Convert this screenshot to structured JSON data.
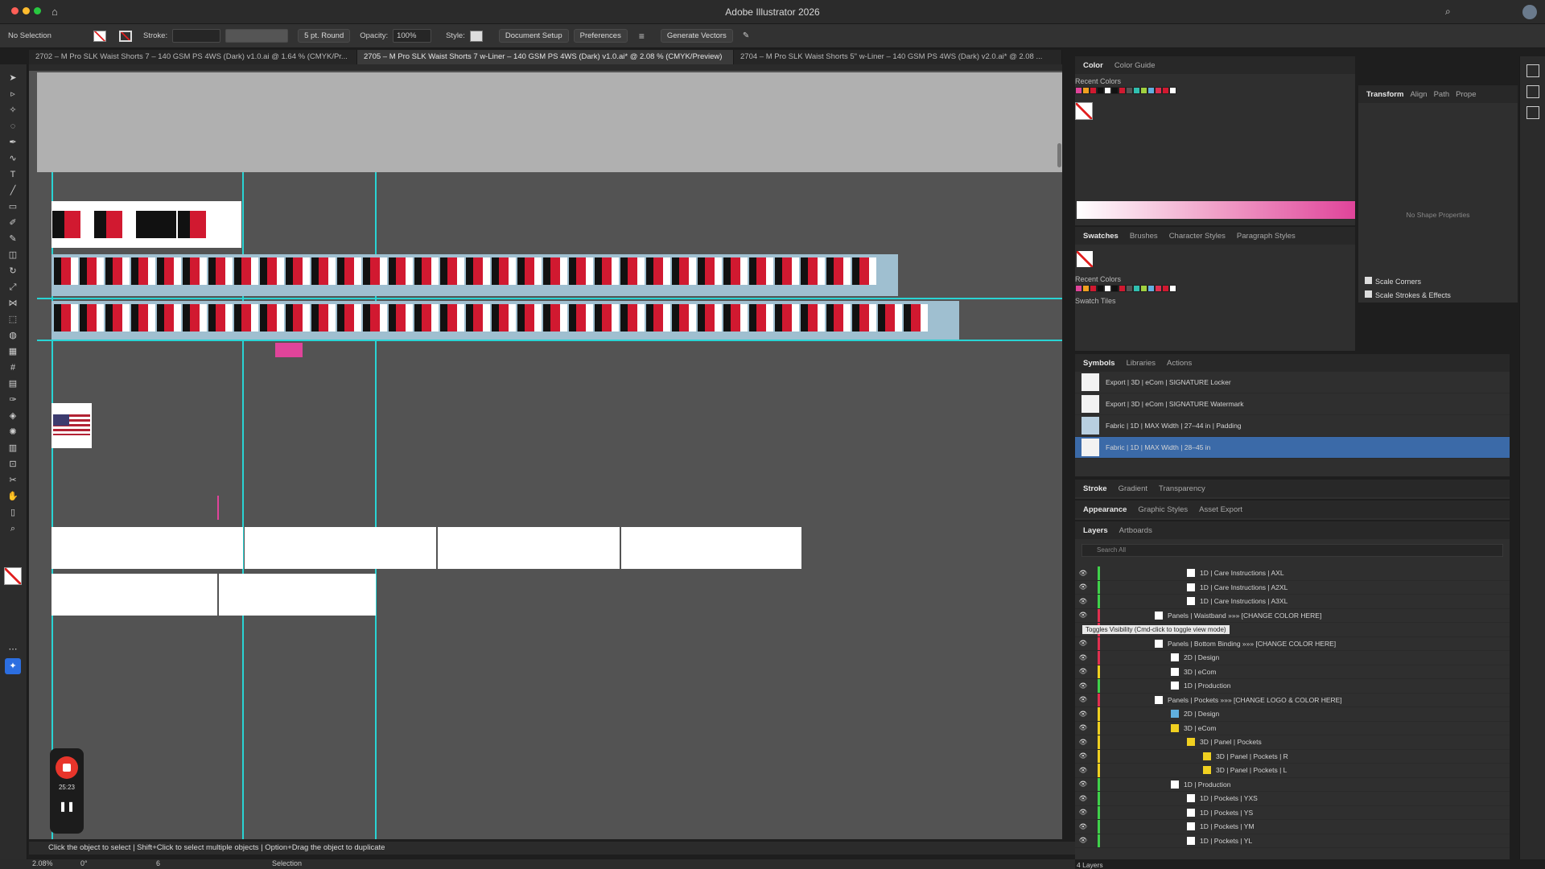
{
  "app": {
    "title": "Adobe Illustrator 2026"
  },
  "control_bar": {
    "selection": "No Selection",
    "stroke_label": "Stroke:",
    "brush": "5 pt. Round",
    "opacity_label": "Opacity:",
    "opacity_value": "100%",
    "style_label": "Style:",
    "document_setup": "Document Setup",
    "preferences": "Preferences",
    "generate_vectors": "Generate Vectors"
  },
  "tabs": [
    "2702 – M Pro SLK Waist Shorts 7 – 140 GSM PS 4WS (Dark) v1.0.ai @ 1.64 % (CMYK/Pr...",
    "2705 – M Pro SLK Waist Shorts 7 w-Liner – 140 GSM PS 4WS (Dark) v1.0.ai* @ 2.08 % (CMYK/Preview)",
    "2704 – M Pro SLK Waist Shorts 5\" w-Liner – 140 GSM PS 4WS (Dark) v2.0.ai* @ 2.08 ..."
  ],
  "color_panel": {
    "tabs": [
      "Color",
      "Color Guide"
    ],
    "recent_colors": "Recent Colors"
  },
  "transform_panel": {
    "tabs": [
      "Transform",
      "Align",
      "Path",
      "Prope"
    ],
    "no_shape": "No Shape Properties",
    "scale_corners": "Scale Corners",
    "scale_strokes": "Scale Strokes & Effects"
  },
  "swatches_panel": {
    "tabs": [
      "Swatches",
      "Brushes",
      "Character Styles",
      "Paragraph Styles"
    ],
    "recent_colors": "Recent Colors",
    "swatch_tiles": "Swatch Tiles"
  },
  "symbols_panel": {
    "tabs": [
      "Symbols",
      "Libraries",
      "Actions"
    ],
    "items": [
      "Export | 3D | eCom | SIGNATURE Locker",
      "Export | 3D | eCom | SIGNATURE Watermark",
      "Fabric | 1D | MAX Width | 27–44 in | Padding",
      "Fabric | 1D | MAX Width | 28–45 in"
    ]
  },
  "stroke_panel": {
    "tabs": [
      "Stroke",
      "Gradient",
      "Transparency"
    ]
  },
  "appearance_panel": {
    "tabs": [
      "Appearance",
      "Graphic Styles",
      "Asset Export"
    ]
  },
  "layers_panel": {
    "tabs": [
      "Layers",
      "Artboards"
    ],
    "search_placeholder": "Search All",
    "tooltip": "Toggles Visibility (Cmd-click to toggle view mode)",
    "footer": "4 Layers",
    "rows": [
      "1D | Care Instructions | AXL",
      "1D | Care Instructions | A2XL",
      "1D | Care Instructions | A3XL",
      "Panels | Waistband »»» [CHANGE COLOR HERE]",
      "",
      "Panels | Bottom Binding »»» [CHANGE COLOR HERE]",
      "2D | Design",
      "3D | eCom",
      "1D | Production",
      "Panels | Pockets »»» [CHANGE LOGO & COLOR HERE]",
      "2D | Design",
      "3D | eCom",
      "3D | Panel | Pockets",
      "3D | Panel | Pockets | R",
      "3D | Panel | Pockets | L",
      "1D | Production",
      "1D | Pockets | YXS",
      "1D | Pockets | YS",
      "1D | Pockets | YM",
      "1D | Pockets | YL"
    ]
  },
  "status": {
    "zoom": "2.08%",
    "rotation": "0°",
    "artboard": "6",
    "tool": "Selection",
    "hint": "Click the object to select  |  Shift+Click to select multiple objects  |  Option+Drag the object to duplicate"
  },
  "recorder": {
    "time": "25:23"
  },
  "colors": {
    "accent": "#3b6aa8",
    "red": "#d11930",
    "pink": "#e0449a",
    "guide": "#29d4d4"
  }
}
